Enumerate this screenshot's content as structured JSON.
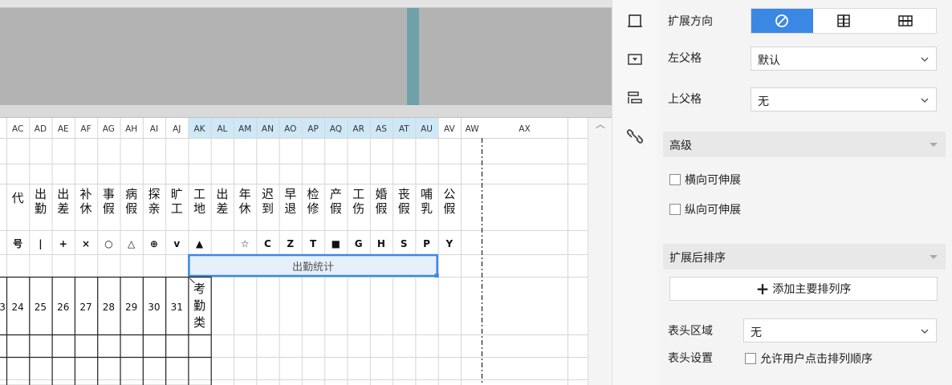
{
  "sheet": {
    "columns": [
      "AC",
      "AD",
      "AE",
      "AF",
      "AG",
      "AH",
      "AI",
      "AJ",
      "AK",
      "AL",
      "AM",
      "AN",
      "AO",
      "AP",
      "AQ",
      "AR",
      "AS",
      "AT",
      "AU",
      "AV",
      "AW"
    ],
    "extra_column": "AX",
    "leave_types": [
      "代",
      "出勤",
      "出差",
      "补休",
      "事假",
      "病假",
      "探亲",
      "旷工",
      "工地",
      "出差",
      "年休",
      "迟到",
      "早退",
      "检修",
      "产假",
      "工伤",
      "婚假",
      "丧假",
      "哺乳",
      "公假"
    ],
    "symbols": [
      "号",
      "|",
      "+",
      "×",
      "○",
      "△",
      "⊕",
      "v",
      "▲",
      "",
      "☆",
      "C",
      "Z",
      "T",
      "■",
      "G",
      "H",
      "S",
      "P",
      "Y"
    ],
    "merged_cell_text": "出勤统计",
    "day_numbers": [
      "24",
      "25",
      "26",
      "27",
      "28",
      "29",
      "30",
      "31"
    ],
    "partial_day": "3",
    "category_text": "考勤类"
  },
  "panel": {
    "expand_direction_label": "扩展方向",
    "left_parent_label": "左父格",
    "left_parent_value": "默认",
    "top_parent_label": "上父格",
    "top_parent_value": "无",
    "advanced_label": "高级",
    "horizontal_expand_label": "横向可伸展",
    "vertical_expand_label": "纵向可伸展",
    "sort_after_expand_label": "扩展后排序",
    "add_sort_label": "添加主要排列序",
    "header_area_label": "表头区域",
    "header_area_value": "无",
    "header_settings_label": "表头设置",
    "allow_user_sort_label": "允许用户点击排列顺序"
  },
  "colors": {
    "accent": "#3b88e4",
    "selection_border": "#3b88e4",
    "selection_fill": "#e6f0fb",
    "column_header_highlight": "#cfe8f7"
  },
  "icons": [
    "cell-box-icon",
    "cell-dropdown-icon",
    "widget-icon",
    "link-icon",
    "none-icon",
    "horizontal-grid-icon",
    "vertical-grid-icon",
    "chevron-down-icon"
  ]
}
